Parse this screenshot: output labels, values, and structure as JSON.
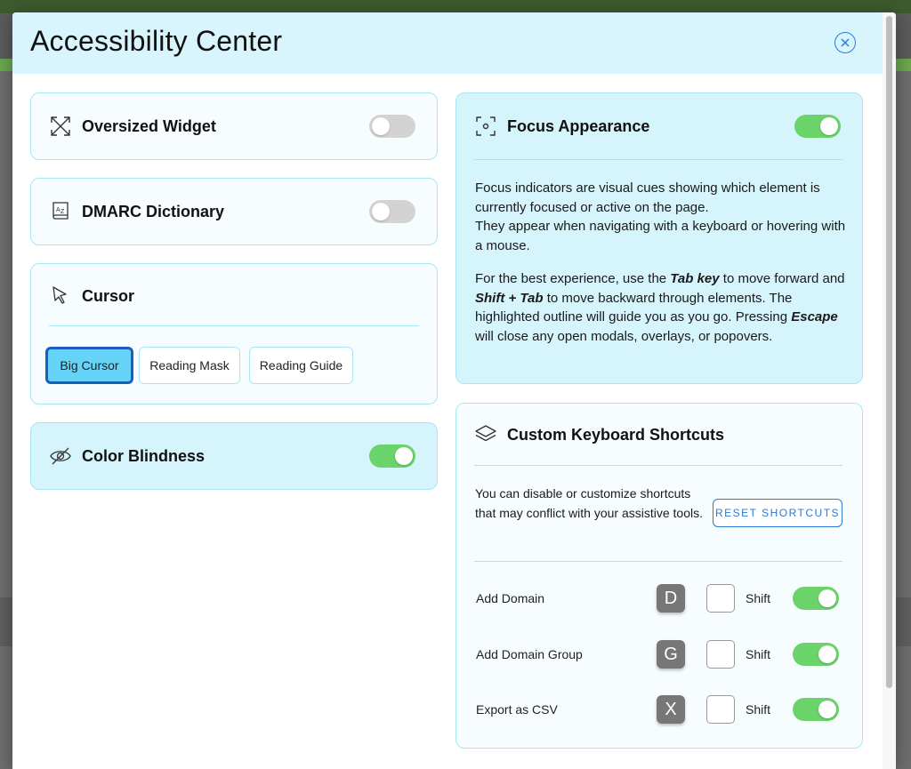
{
  "modal": {
    "title": "Accessibility Center",
    "close_icon": "close-icon"
  },
  "left": {
    "oversized": {
      "label": "Oversized Widget",
      "icon": "expand-arrows-icon",
      "enabled": false
    },
    "dictionary": {
      "label": "DMARC Dictionary",
      "icon": "dictionary-icon",
      "enabled": false
    },
    "cursor": {
      "label": "Cursor",
      "icon": "cursor-arrow-icon",
      "options": [
        "Big Cursor",
        "Reading Mask",
        "Reading Guide"
      ],
      "selected": "Big Cursor"
    },
    "color_blindness": {
      "label": "Color Blindness",
      "icon": "eye-slash-icon",
      "enabled": true
    }
  },
  "focus": {
    "label": "Focus Appearance",
    "icon": "focus-frame-icon",
    "enabled": true,
    "para1_line1": "Focus indicators are visual cues showing which element is currently focused or active on the page.",
    "para1_line2": "They appear when navigating with a keyboard or hovering with a mouse.",
    "para2_a": "For the best experience, use the ",
    "para2_tab": "Tab key",
    "para2_b": " to move forward and ",
    "para2_shift": "Shift + Tab",
    "para2_c": " to move backward through elements. The highlighted outline will guide you as you go. Pressing ",
    "para2_escape": "Escape",
    "para2_d": " will close any open modals, overlays, or popovers."
  },
  "shortcuts": {
    "label": "Custom Keyboard Shortcuts",
    "icon": "layers-icon",
    "description": "You can disable or customize shortcuts that may conflict with your assistive tools.",
    "reset_label": "RESET SHORTCUTS",
    "items": [
      {
        "label": "Add Domain",
        "key": "D",
        "modifier": "Shift",
        "shift_checked": false,
        "enabled": true
      },
      {
        "label": "Add Domain Group",
        "key": "G",
        "modifier": "Shift",
        "shift_checked": false,
        "enabled": true
      },
      {
        "label": "Export as CSV",
        "key": "X",
        "modifier": "Shift",
        "shift_checked": false,
        "enabled": true
      }
    ]
  },
  "colors": {
    "header_bg": "#d8f4fc",
    "card_border": "#a9e6f5",
    "toggle_on": "#6ad36a",
    "toggle_off": "#d3d3d3",
    "selected_chip": "#66d4f6",
    "accent_blue": "#2a7ad6"
  }
}
